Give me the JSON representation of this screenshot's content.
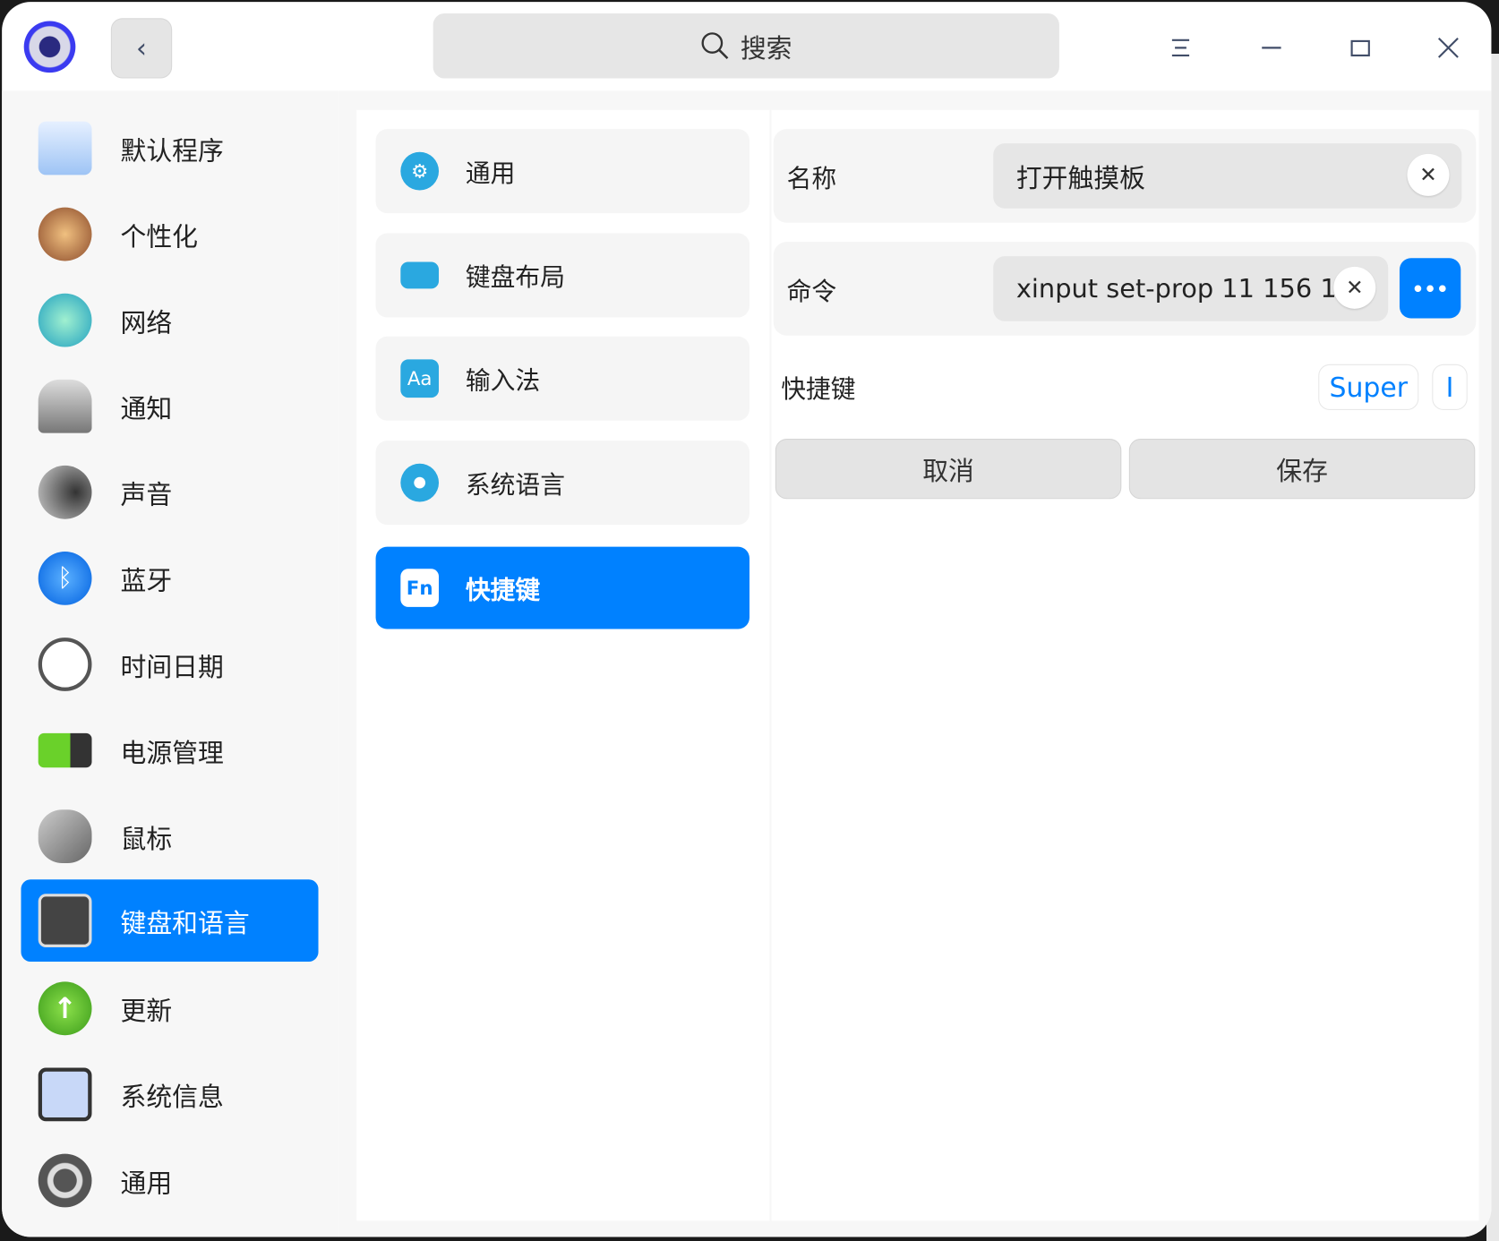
{
  "titlebar": {
    "search_placeholder": "搜索",
    "icons": [
      "app-logo",
      "back",
      "search",
      "menu",
      "minimize",
      "maximize",
      "close"
    ]
  },
  "sidebar": {
    "items": [
      {
        "label": "默认程序",
        "icon": "default-apps-icon"
      },
      {
        "label": "个性化",
        "icon": "personalization-icon"
      },
      {
        "label": "网络",
        "icon": "network-icon"
      },
      {
        "label": "通知",
        "icon": "notification-icon"
      },
      {
        "label": "声音",
        "icon": "sound-icon"
      },
      {
        "label": "蓝牙",
        "icon": "bluetooth-icon"
      },
      {
        "label": "时间日期",
        "icon": "clock-icon"
      },
      {
        "label": "电源管理",
        "icon": "battery-icon"
      },
      {
        "label": "鼠标",
        "icon": "mouse-icon"
      },
      {
        "label": "键盘和语言",
        "icon": "keyboard-icon",
        "active": true
      },
      {
        "label": "更新",
        "icon": "update-icon"
      },
      {
        "label": "系统信息",
        "icon": "system-info-icon"
      },
      {
        "label": "通用",
        "icon": "general-icon"
      }
    ]
  },
  "submenu": {
    "items": [
      {
        "label": "通用",
        "icon": "gear-icon"
      },
      {
        "label": "键盘布局",
        "icon": "keyboard-layout-icon"
      },
      {
        "label": "输入法",
        "icon": "input-method-icon",
        "glyph": "Aa"
      },
      {
        "label": "系统语言",
        "icon": "globe-icon"
      },
      {
        "label": "快捷键",
        "icon": "fn-icon",
        "glyph": "Fn",
        "active": true
      }
    ]
  },
  "form": {
    "name_label": "名称",
    "name_value": "打开触摸板",
    "command_label": "命令",
    "command_value": "xinput set-prop 11 156 1",
    "more_button": "•••",
    "shortcut_label": "快捷键",
    "shortcut_keys": [
      "Super",
      "I"
    ],
    "cancel": "取消",
    "save": "保存"
  },
  "colors": {
    "accent": "#0081ff"
  }
}
